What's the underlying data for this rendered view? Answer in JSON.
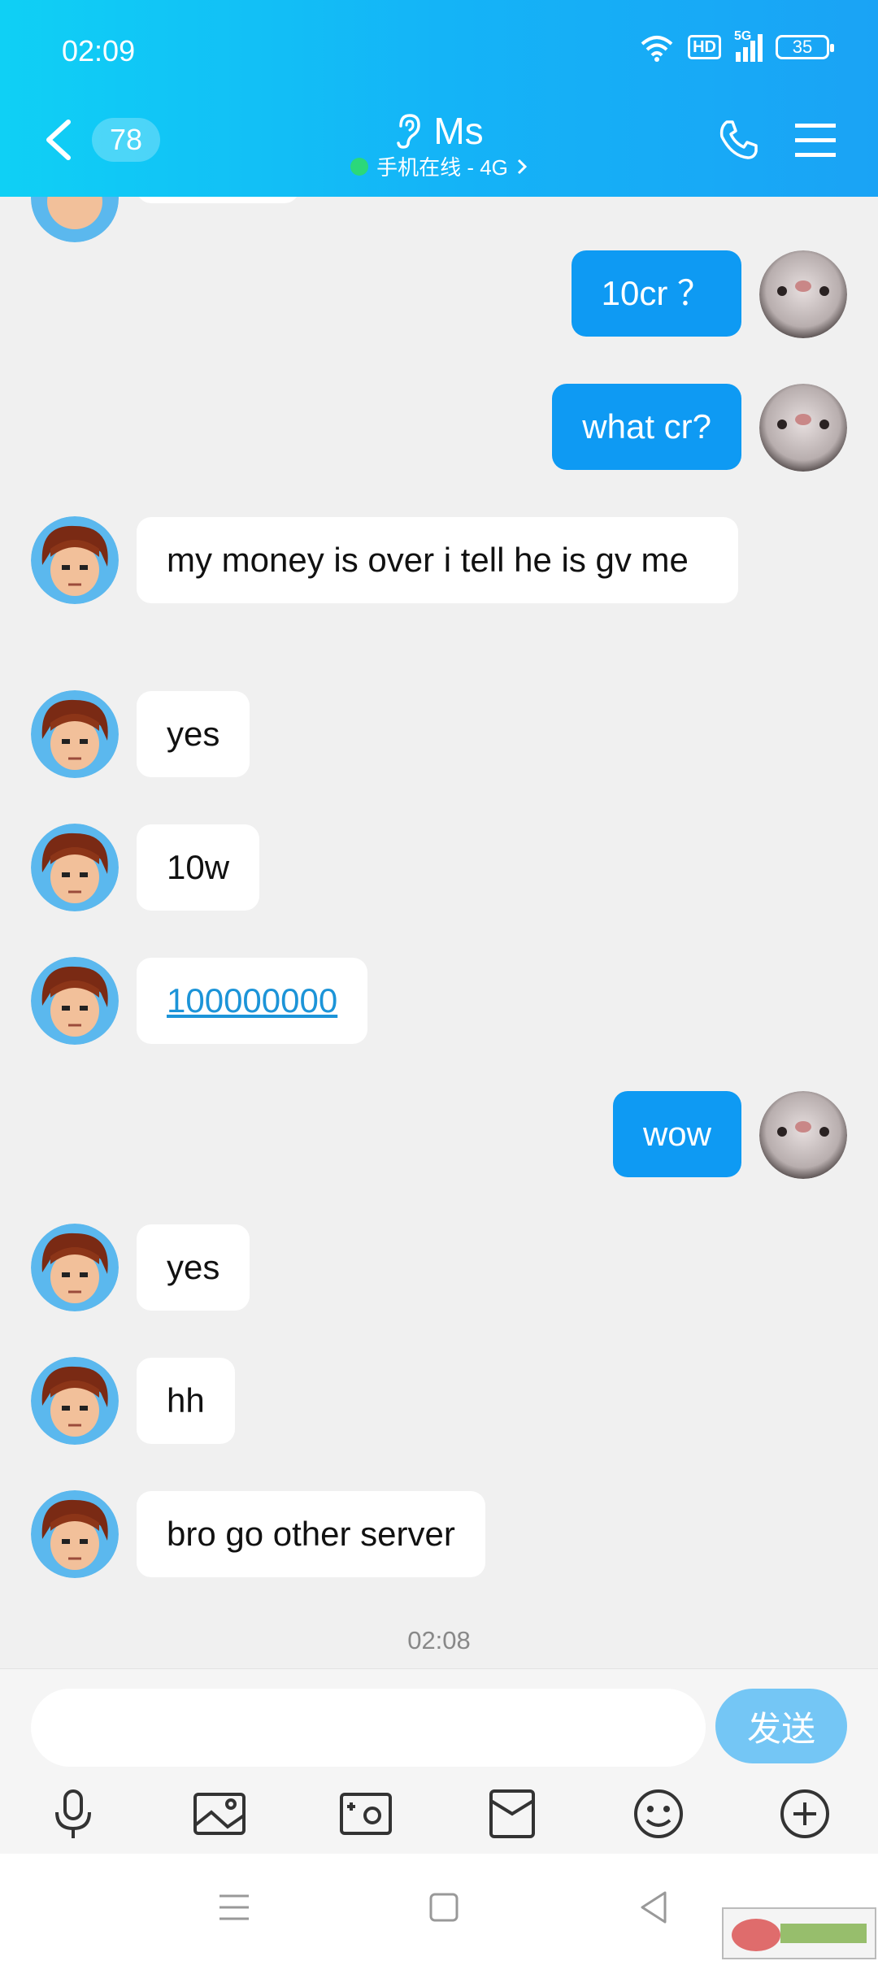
{
  "status_bar": {
    "time": "02:09",
    "hd_label": "HD",
    "network_label": "5G",
    "battery_level": "35"
  },
  "header": {
    "unread_count": "78",
    "contact_name": "Ms",
    "online_status": "手机在线 - 4G"
  },
  "messages": [
    {
      "side": "out",
      "text": "10cr ？"
    },
    {
      "side": "out",
      "text": "what cr?"
    },
    {
      "side": "in",
      "text": "my money is over i tell he is gv me"
    },
    {
      "side": "in",
      "text": "yes"
    },
    {
      "side": "in",
      "text": "10w"
    },
    {
      "side": "in",
      "text": "100000000",
      "is_link": true
    },
    {
      "side": "out",
      "text": "wow"
    },
    {
      "side": "in",
      "text": "yes"
    },
    {
      "side": "in",
      "text": "hh"
    },
    {
      "side": "in",
      "text": "bro go other server"
    }
  ],
  "timestamp": "02:08",
  "composer": {
    "input_value": "",
    "send_label": "发送"
  },
  "toolbar_icons": [
    "microphone-icon",
    "image-icon",
    "camera-icon",
    "red-packet-icon",
    "emoji-icon",
    "plus-icon"
  ],
  "nav_icons": [
    "recent-apps-icon",
    "home-icon",
    "back-icon"
  ],
  "colors": {
    "header_start": "#0fd0f5",
    "header_end": "#1aa3f5",
    "outgoing_bubble": "#0e9af3",
    "send_button": "#74c6f5",
    "chat_background": "#f0f0f0"
  }
}
